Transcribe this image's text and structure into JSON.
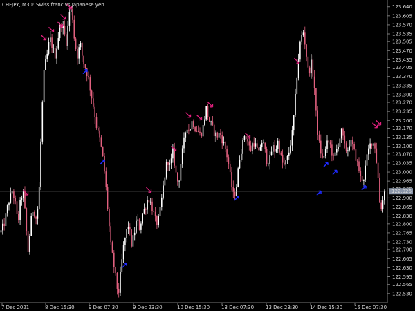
{
  "header": {
    "symbol_timeframe": "CHFJPY,,M30:",
    "description": "Swiss franc vs Japanese yen"
  },
  "colors": {
    "background": "#000000",
    "bull_candle": "#ffffff",
    "bear_candle": "#e0607e",
    "sell_arrow": "#e0207e",
    "buy_arrow": "#1e2aff",
    "price_line": "#777777",
    "price_tag_bg": "#8a95a8",
    "axis": "#777777"
  },
  "chart_data": {
    "type": "candlestick",
    "ylim": [
      122.5,
      123.65
    ],
    "y_ticks": [
      "123.640",
      "123.605",
      "123.570",
      "123.535",
      "123.505",
      "123.470",
      "123.435",
      "123.405",
      "123.370",
      "123.335",
      "123.300",
      "123.270",
      "123.235",
      "123.200",
      "123.170",
      "123.135",
      "123.100",
      "123.070",
      "123.035",
      "123.000",
      "122.965",
      "122.935",
      "122.900",
      "122.865",
      "122.830",
      "122.800",
      "122.765",
      "122.730",
      "122.700",
      "122.665",
      "122.630",
      "122.595",
      "122.565",
      "122.530"
    ],
    "x_ticks": [
      "7 Dec 2021",
      "8 Dec 15:30",
      "9 Dec 07:30",
      "9 Dec 23:30",
      "10 Dec 15:30",
      "13 Dec 07:30",
      "13 Dec 23:30",
      "14 Dec 15:30",
      "15 Dec 07:30"
    ],
    "current_price": "122.926",
    "current_price_value": 122.926,
    "price_path": [
      [
        0,
        122.76
      ],
      [
        6,
        122.8
      ],
      [
        12,
        122.88
      ],
      [
        18,
        122.93
      ],
      [
        22,
        122.88
      ],
      [
        26,
        122.8
      ],
      [
        30,
        122.9
      ],
      [
        34,
        122.92
      ],
      [
        38,
        122.78
      ],
      [
        41,
        122.68
      ],
      [
        44,
        122.8
      ],
      [
        48,
        122.86
      ],
      [
        52,
        122.82
      ],
      [
        56,
        122.88
      ],
      [
        58,
        123.05
      ],
      [
        61,
        123.25
      ],
      [
        64,
        123.4
      ],
      [
        68,
        123.45
      ],
      [
        72,
        123.52
      ],
      [
        76,
        123.48
      ],
      [
        80,
        123.45
      ],
      [
        84,
        123.52
      ],
      [
        88,
        123.58
      ],
      [
        92,
        123.55
      ],
      [
        96,
        123.5
      ],
      [
        100,
        123.62
      ],
      [
        104,
        123.63
      ],
      [
        108,
        123.5
      ],
      [
        112,
        123.45
      ],
      [
        116,
        123.5
      ],
      [
        120,
        123.43
      ],
      [
        124,
        123.4
      ],
      [
        128,
        123.36
      ],
      [
        132,
        123.3
      ],
      [
        136,
        123.24
      ],
      [
        140,
        123.17
      ],
      [
        144,
        123.13
      ],
      [
        148,
        123.07
      ],
      [
        152,
        122.98
      ],
      [
        156,
        122.85
      ],
      [
        160,
        122.72
      ],
      [
        164,
        122.65
      ],
      [
        168,
        122.58
      ],
      [
        171,
        122.52
      ],
      [
        174,
        122.6
      ],
      [
        178,
        122.7
      ],
      [
        182,
        122.76
      ],
      [
        186,
        122.8
      ],
      [
        190,
        122.72
      ],
      [
        194,
        122.76
      ],
      [
        198,
        122.82
      ],
      [
        202,
        122.78
      ],
      [
        206,
        122.84
      ],
      [
        210,
        122.86
      ],
      [
        214,
        122.9
      ],
      [
        218,
        122.88
      ],
      [
        222,
        122.84
      ],
      [
        226,
        122.8
      ],
      [
        230,
        122.82
      ],
      [
        234,
        122.9
      ],
      [
        238,
        122.98
      ],
      [
        242,
        123.05
      ],
      [
        246,
        123.02
      ],
      [
        250,
        123.08
      ],
      [
        254,
        123.0
      ],
      [
        258,
        122.95
      ],
      [
        262,
        123.05
      ],
      [
        266,
        123.12
      ],
      [
        270,
        123.18
      ],
      [
        274,
        123.16
      ],
      [
        278,
        123.2
      ],
      [
        282,
        123.17
      ],
      [
        286,
        123.16
      ],
      [
        290,
        123.14
      ],
      [
        294,
        123.18
      ],
      [
        298,
        123.25
      ],
      [
        302,
        123.2
      ],
      [
        306,
        123.18
      ],
      [
        310,
        123.15
      ],
      [
        314,
        123.14
      ],
      [
        318,
        123.15
      ],
      [
        322,
        123.12
      ],
      [
        326,
        123.09
      ],
      [
        330,
        123.04
      ],
      [
        334,
        122.96
      ],
      [
        338,
        122.9
      ],
      [
        342,
        122.95
      ],
      [
        346,
        123.05
      ],
      [
        350,
        123.1
      ],
      [
        354,
        123.15
      ],
      [
        358,
        123.12
      ],
      [
        362,
        123.08
      ],
      [
        366,
        123.12
      ],
      [
        370,
        123.1
      ],
      [
        374,
        123.07
      ],
      [
        378,
        123.12
      ],
      [
        382,
        123.1
      ],
      [
        386,
        123.04
      ],
      [
        390,
        123.05
      ],
      [
        394,
        123.1
      ],
      [
        398,
        123.08
      ],
      [
        402,
        123.12
      ],
      [
        406,
        123.06
      ],
      [
        410,
        123.02
      ],
      [
        414,
        123.04
      ],
      [
        418,
        123.08
      ],
      [
        422,
        123.14
      ],
      [
        426,
        123.25
      ],
      [
        430,
        123.4
      ],
      [
        434,
        123.5
      ],
      [
        438,
        123.55
      ],
      [
        442,
        123.48
      ],
      [
        446,
        123.38
      ],
      [
        450,
        123.42
      ],
      [
        454,
        123.35
      ],
      [
        458,
        123.18
      ],
      [
        462,
        123.1
      ],
      [
        466,
        123.05
      ],
      [
        470,
        123.08
      ],
      [
        474,
        123.12
      ],
      [
        478,
        123.1
      ],
      [
        482,
        123.05
      ],
      [
        486,
        123.08
      ],
      [
        490,
        123.12
      ],
      [
        494,
        123.16
      ],
      [
        498,
        123.1
      ],
      [
        502,
        123.08
      ],
      [
        506,
        123.12
      ],
      [
        510,
        123.1
      ],
      [
        514,
        123.06
      ],
      [
        518,
        123.02
      ],
      [
        522,
        122.97
      ],
      [
        526,
        122.98
      ],
      [
        530,
        123.05
      ],
      [
        534,
        123.1
      ],
      [
        538,
        123.12
      ],
      [
        542,
        123.1
      ],
      [
        546,
        123.0
      ],
      [
        549,
        122.88
      ],
      [
        552,
        122.86
      ],
      [
        556,
        122.94
      ],
      [
        560,
        122.92
      ]
    ],
    "sell_arrows": [
      [
        37,
        122.92
      ],
      [
        63,
        123.52
      ],
      [
        74,
        123.55
      ],
      [
        87,
        123.57
      ],
      [
        91,
        123.6
      ],
      [
        100,
        123.64
      ],
      [
        215,
        122.93
      ],
      [
        251,
        123.09
      ],
      [
        272,
        123.22
      ],
      [
        288,
        123.21
      ],
      [
        304,
        123.26
      ],
      [
        358,
        123.14
      ],
      [
        429,
        123.43
      ],
      [
        542,
        123.18
      ],
      [
        547,
        123.19
      ]
    ],
    "buy_arrows": [
      [
        123,
        123.39
      ],
      [
        148,
        123.04
      ],
      [
        180,
        122.64
      ],
      [
        342,
        122.9
      ],
      [
        461,
        122.92
      ],
      [
        471,
        123.03
      ],
      [
        484,
        123.0
      ],
      [
        526,
        122.94
      ]
    ]
  }
}
